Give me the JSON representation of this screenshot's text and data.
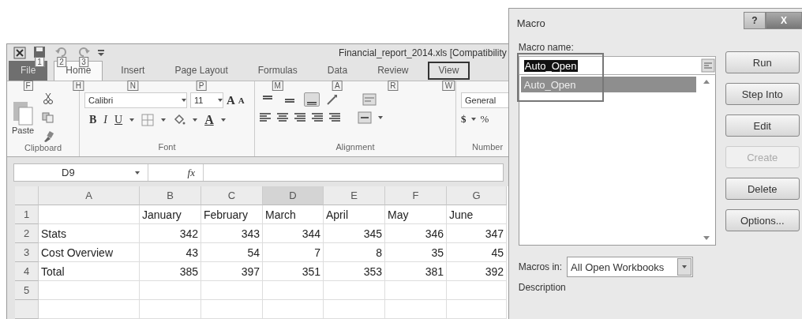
{
  "excel": {
    "title": "Financial_report_2014.xls  [Compatibility",
    "quick_access": [
      {
        "kind": "save",
        "keytip": "1"
      },
      {
        "kind": "undo",
        "keytip": "2"
      },
      {
        "kind": "redo",
        "keytip": "3"
      }
    ],
    "tabs": [
      {
        "label": "File",
        "keytip": "F",
        "kind": "file",
        "selected": false,
        "highlighted": false
      },
      {
        "label": "Home",
        "keytip": "H",
        "kind": "tab",
        "selected": true,
        "highlighted": false
      },
      {
        "label": "Insert",
        "keytip": "N",
        "kind": "tab",
        "selected": false,
        "highlighted": false
      },
      {
        "label": "Page Layout",
        "keytip": "P",
        "kind": "tab",
        "selected": false,
        "highlighted": false
      },
      {
        "label": "Formulas",
        "keytip": "M",
        "kind": "tab",
        "selected": false,
        "highlighted": false
      },
      {
        "label": "Data",
        "keytip": "A",
        "kind": "tab",
        "selected": false,
        "highlighted": false
      },
      {
        "label": "Review",
        "keytip": "R",
        "kind": "tab",
        "selected": false,
        "highlighted": false
      },
      {
        "label": "View",
        "keytip": "W",
        "kind": "tab",
        "selected": false,
        "highlighted": true
      }
    ],
    "ribbon": {
      "clipboard": {
        "paste": "Paste",
        "label": "Clipboard"
      },
      "font": {
        "name": "Calibri",
        "size": "11",
        "grow": "A",
        "shrink": "A",
        "bold": "B",
        "italic": "I",
        "underline": "U",
        "font_color_label": "A",
        "label": "Font"
      },
      "alignment": {
        "label": "Alignment",
        "buttons": [
          {
            "kind": "top",
            "selected": false
          },
          {
            "kind": "middle",
            "selected": false
          },
          {
            "kind": "bottom",
            "selected": true
          }
        ]
      },
      "number": {
        "format": "General",
        "currency": "$",
        "percent": "%",
        "label": "Number"
      }
    },
    "formula_bar": {
      "name_box": "D9",
      "function_label": "fx"
    },
    "sheet": {
      "columns": [
        {
          "label": "A",
          "selected": false
        },
        {
          "label": "B",
          "selected": false
        },
        {
          "label": "C",
          "selected": false
        },
        {
          "label": "D",
          "selected": true
        },
        {
          "label": "E",
          "selected": false
        },
        {
          "label": "F",
          "selected": false
        },
        {
          "label": "G",
          "selected": false
        }
      ],
      "rows": [
        {
          "number": "1",
          "values": [
            "January",
            "February",
            "March",
            "April",
            "May",
            "June"
          ]
        },
        {
          "number": "2",
          "label": "Stats",
          "values": [
            "342",
            "343",
            "344",
            "345",
            "346",
            "347"
          ]
        },
        {
          "number": "3",
          "label": "Cost Overview",
          "values": [
            "43",
            "54",
            "7",
            "8",
            "35",
            "45"
          ]
        },
        {
          "number": "4",
          "label": "Total",
          "values": [
            "385",
            "397",
            "351",
            "353",
            "381",
            "392"
          ]
        },
        {
          "number": "5"
        }
      ]
    }
  },
  "macro_dialog": {
    "title": "Macro",
    "help": "?",
    "close": "X",
    "macro_name": {
      "label": "Macro name:",
      "value": "Auto_Open",
      "highlighted": true
    },
    "macros": [
      {
        "label": "Auto_Open",
        "selected": true
      }
    ],
    "buttons": [
      {
        "label": "Run",
        "disabled": false
      },
      {
        "label": "Step Into",
        "disabled": false
      },
      {
        "label": "Edit",
        "disabled": false
      },
      {
        "label": "Create",
        "disabled": true
      },
      {
        "label": "Delete",
        "disabled": false
      },
      {
        "label": "Options...",
        "disabled": false
      }
    ],
    "macros_in": {
      "label": "Macros in:",
      "value": "All Open Workbooks"
    },
    "description": {
      "label": "Description"
    }
  }
}
